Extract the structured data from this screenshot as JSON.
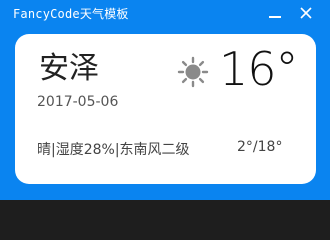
{
  "window": {
    "title": "FancyCode天气模板",
    "minimize_label": "",
    "close_label": "×"
  },
  "weather": {
    "city": "安泽",
    "date": "2017-05-06",
    "condition_icon": "sun-icon",
    "temperature": "16°",
    "details": "晴|湿度28%|东南风二级",
    "range": "2°/18°"
  },
  "colors": {
    "window_bg": "#0a84f0",
    "card_bg": "#ffffff",
    "icon_gray": "#8a8a8a"
  }
}
